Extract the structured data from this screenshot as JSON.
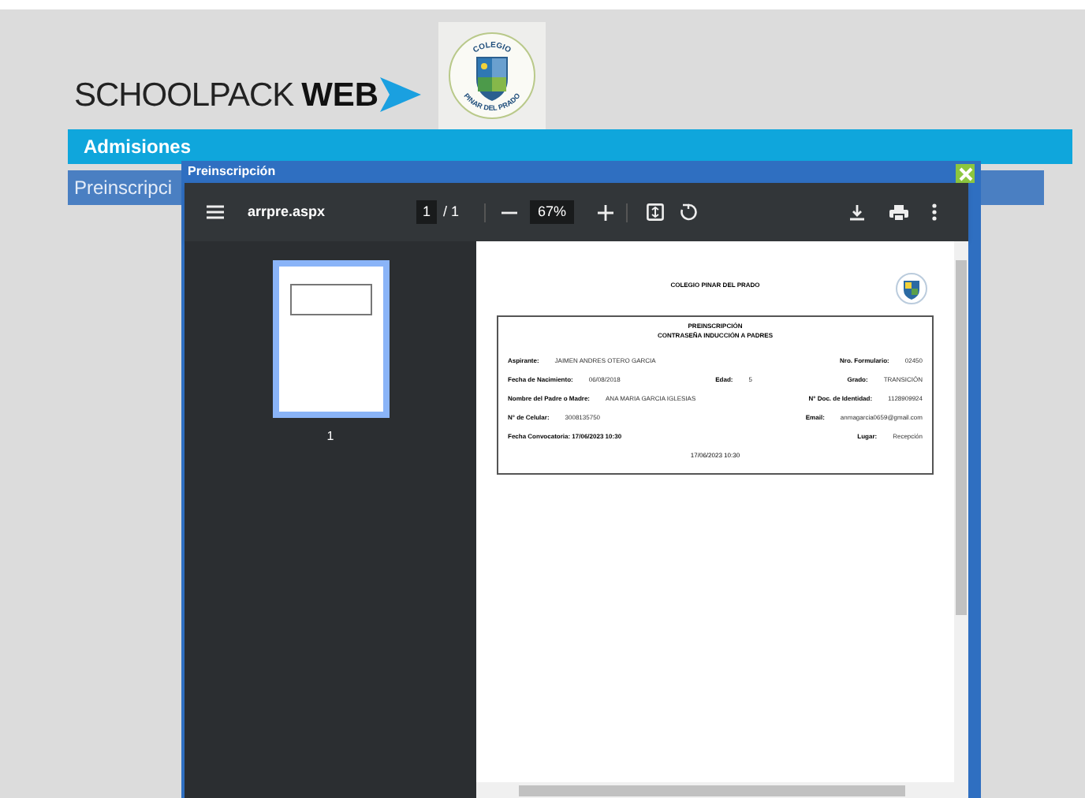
{
  "header": {
    "brand_left": "SCHOOLPACK",
    "brand_right": "WEB",
    "crest_top": "COLEGIO",
    "crest_bottom": "PINAR DEL PRADO"
  },
  "menu": {
    "title": "Admisiones",
    "submenu": "Preinscripci"
  },
  "modal": {
    "title": "Preinscripción"
  },
  "viewer": {
    "filename": "arrpre.aspx",
    "page": "1",
    "page_total": "/ 1",
    "zoom": "67%"
  },
  "thumbnails": [
    {
      "label": "1",
      "selected": true
    }
  ],
  "document": {
    "school": "COLEGIO PINAR DEL PRADO",
    "title": "PREINSCRIPCIÓN",
    "subtitle": "CONTRASEÑA INDUCCIÓN A PADRES",
    "rows": [
      [
        {
          "label": "Aspirante:",
          "value": "JAIMEN ANDRES OTERO GARCIA"
        },
        {
          "label": "Nro. Formulario:",
          "value": "02450"
        }
      ],
      [
        {
          "label": "Fecha de Nacimiento:",
          "value": "06/08/2018"
        },
        {
          "label": "Edad:",
          "value": "5"
        },
        {
          "label": "Grado:",
          "value": "TRANSICIÓN"
        }
      ],
      [
        {
          "label": "Nombre del Padre o Madre:",
          "value": "ANA MARIA GARCIA IGLESIAS"
        },
        {
          "label": "N° Doc. de Identidad:",
          "value": "1128909924"
        }
      ],
      [
        {
          "label": "N° de Celular:",
          "value": "3008135750"
        },
        {
          "label": "Email:",
          "value": "anmagarcia0659@gmail.com"
        }
      ],
      [
        {
          "label": "Fecha Convocatoria: 17/06/2023 10:30"
        },
        {
          "label": "Lugar:",
          "value": "Recepción"
        }
      ]
    ],
    "footer": "17/06/2023 10:30"
  }
}
